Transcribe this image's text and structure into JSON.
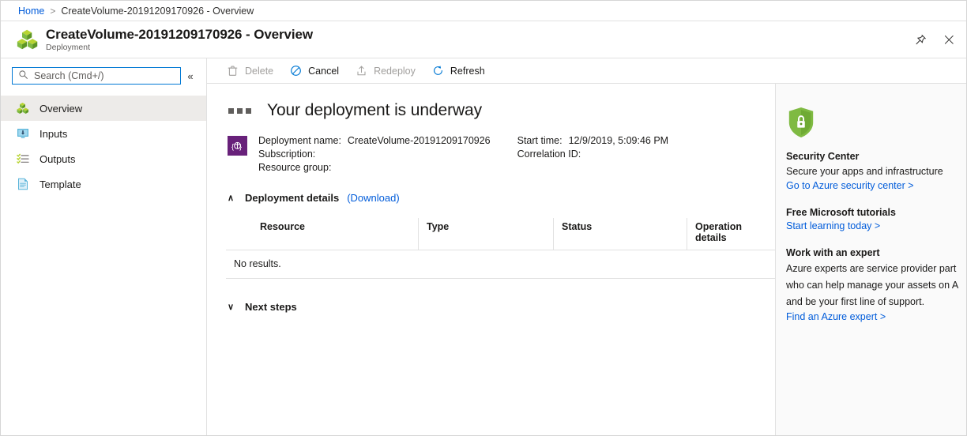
{
  "breadcrumb": {
    "home": "Home",
    "separator": ">",
    "current": "CreateVolume-20191209170926 - Overview"
  },
  "titlebar": {
    "title": "CreateVolume-20191209170926 - Overview",
    "subtitle": "Deployment",
    "pin_icon": "pin-icon",
    "close_icon": "close-icon"
  },
  "sidebar": {
    "search": {
      "placeholder": "Search (Cmd+/)",
      "value": "",
      "icon": "search-icon"
    },
    "collapse_label": "«",
    "items": [
      {
        "label": "Overview",
        "icon": "deployment-cubes-icon",
        "selected": true
      },
      {
        "label": "Inputs",
        "icon": "inputs-monitor-icon",
        "selected": false
      },
      {
        "label": "Outputs",
        "icon": "outputs-list-icon",
        "selected": false
      },
      {
        "label": "Template",
        "icon": "template-document-icon",
        "selected": false
      }
    ]
  },
  "toolbar": {
    "buttons": [
      {
        "label": "Delete",
        "icon": "trash-icon",
        "enabled": false
      },
      {
        "label": "Cancel",
        "icon": "cancel-circle-icon",
        "enabled": true
      },
      {
        "label": "Redeploy",
        "icon": "upload-box-icon",
        "enabled": false
      },
      {
        "label": "Refresh",
        "icon": "refresh-icon",
        "enabled": true
      }
    ]
  },
  "main": {
    "status_title": "Your deployment is underway",
    "status_icon": "progress-dots-icon",
    "resource_icon": "resource-group-icon",
    "meta": {
      "left": [
        {
          "key": "Deployment name:",
          "value": "CreateVolume-20191209170926"
        },
        {
          "key": "Subscription:",
          "value": ""
        },
        {
          "key": "Resource group:",
          "value": ""
        }
      ],
      "right": [
        {
          "key": "Start time:",
          "value": "12/9/2019, 5:09:46 PM"
        },
        {
          "key": "Correlation ID:",
          "value": ""
        }
      ]
    },
    "deployment_details": {
      "label": "Deployment details",
      "download_label": "(Download)",
      "chevron": "∧",
      "expanded": true
    },
    "table": {
      "columns": [
        "Resource",
        "Type",
        "Status",
        "Operation details"
      ],
      "rows": [],
      "empty_text": "No results."
    },
    "next_steps": {
      "label": "Next steps",
      "chevron": "∨",
      "expanded": false
    }
  },
  "right_panel": {
    "cards": [
      {
        "icon": "security-shield-icon",
        "title": "Security Center",
        "description": "Secure your apps and infrastructure",
        "link": "Go to Azure security center >"
      },
      {
        "icon": "",
        "title": "Free Microsoft tutorials",
        "description": "",
        "link": "Start learning today >"
      },
      {
        "icon": "",
        "title": "Work with an expert",
        "description_lines": [
          "Azure experts are service provider part",
          "who can help manage your assets on A",
          "and be your first line of support."
        ],
        "link": "Find an Azure expert >"
      }
    ]
  },
  "colors": {
    "link": "#015cda",
    "accent_blue": "#0078d4",
    "purple": "#68217a",
    "green": "#7fba42",
    "selected_row": "#edebe9",
    "border": "#e1e1e1",
    "panel_bg": "#fafafa",
    "disabled_text": "#a19f9d"
  }
}
